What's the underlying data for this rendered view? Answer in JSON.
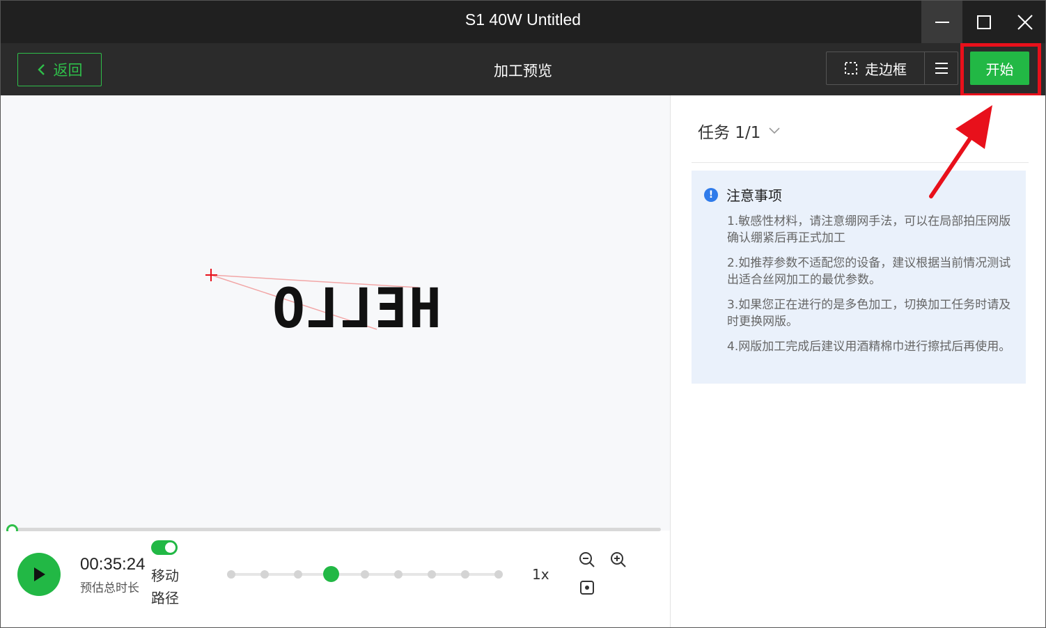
{
  "window": {
    "title": "S1 40W Untitled"
  },
  "toolbar": {
    "back_label": "返回",
    "page_title": "加工预览",
    "frame_label": "走边框",
    "start_label": "开始"
  },
  "canvas": {
    "preview_text": "HELLO"
  },
  "playback": {
    "time": "00:35:24",
    "time_label": "预估总时长",
    "toggle_label": "移动路径",
    "toggle_on": true,
    "speed_levels": 9,
    "speed_selected_index": 3,
    "speed_label": "1x"
  },
  "task": {
    "selector_label": "任务 1/1"
  },
  "notice": {
    "title": "注意事项",
    "items": [
      "1.敏感性材料，请注意绷网手法，可以在局部拍压网版确认绷紧后再正式加工",
      "2.如推荐参数不适配您的设备，建议根据当前情况测试出适合丝网加工的最优参数。",
      "3.如果您正在进行的是多色加工，切换加工任务时请及时更换网版。",
      "4.网版加工完成后建议用酒精棉巾进行擦拭后再使用。"
    ]
  },
  "colors": {
    "accent": "#22b845",
    "annotation": "#e8101b",
    "info": "#2f7bea"
  }
}
